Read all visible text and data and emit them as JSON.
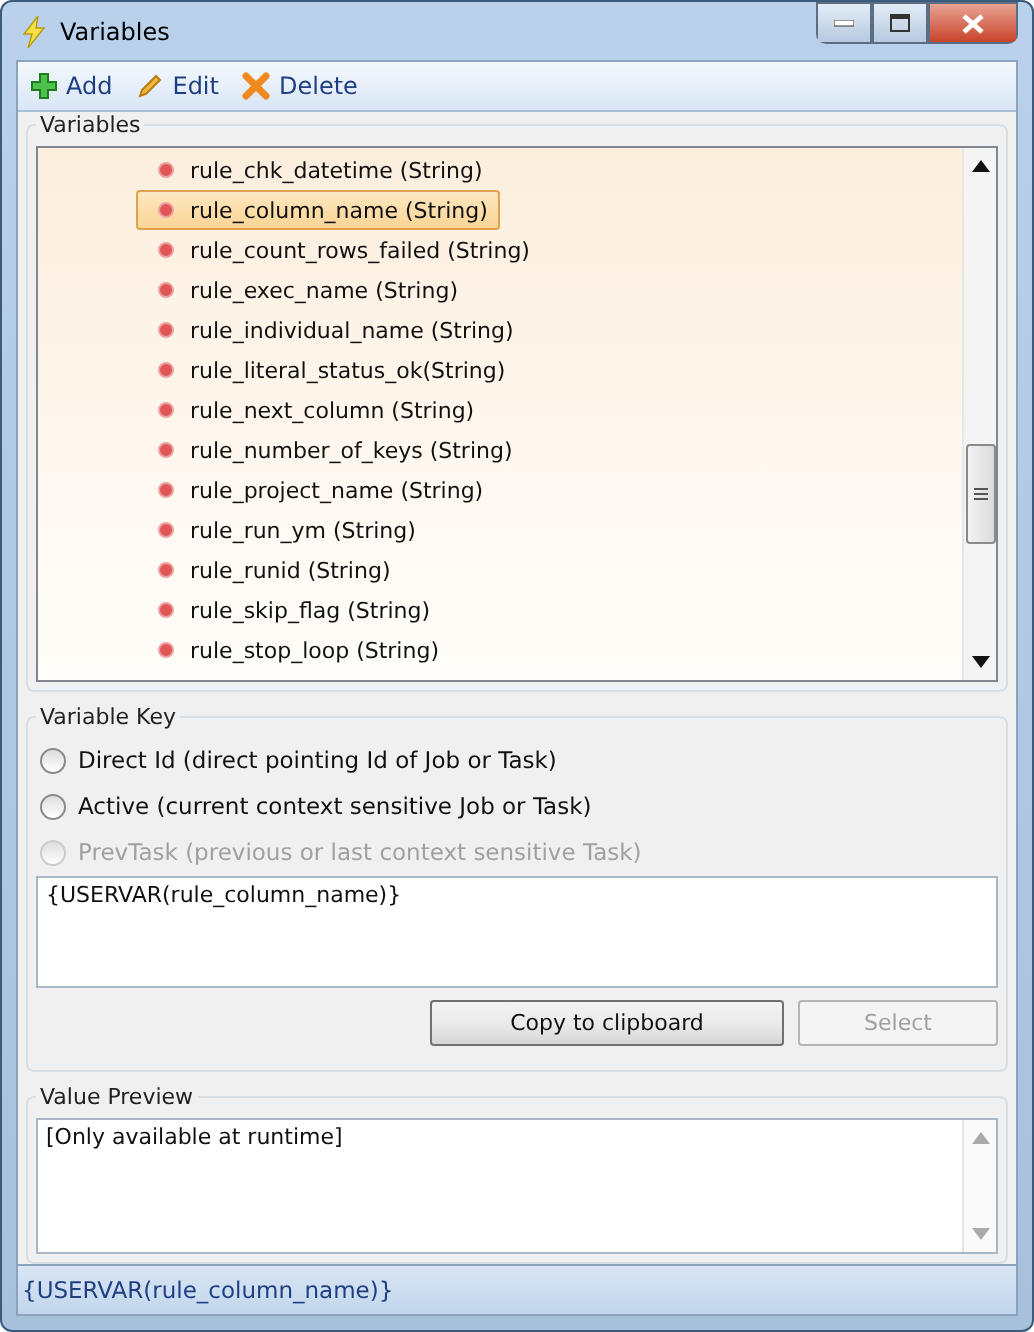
{
  "window": {
    "title": "Variables"
  },
  "toolbar": [
    {
      "kind": "add",
      "label": "Add"
    },
    {
      "kind": "edit",
      "label": "Edit"
    },
    {
      "kind": "delete",
      "label": "Delete"
    }
  ],
  "variables": {
    "title": "Variables",
    "items": [
      {
        "label": "rule_chk_datetime (String)",
        "selected": false
      },
      {
        "label": "rule_column_name (String)",
        "selected": true
      },
      {
        "label": "rule_count_rows_failed (String)",
        "selected": false
      },
      {
        "label": "rule_exec_name (String)",
        "selected": false
      },
      {
        "label": "rule_individual_name (String)",
        "selected": false
      },
      {
        "label": "rule_literal_status_ok(String)",
        "selected": false
      },
      {
        "label": "rule_next_column (String)",
        "selected": false
      },
      {
        "label": "rule_number_of_keys (String)",
        "selected": false
      },
      {
        "label": "rule_project_name (String)",
        "selected": false
      },
      {
        "label": "rule_run_ym (String)",
        "selected": false
      },
      {
        "label": "rule_runid (String)",
        "selected": false
      },
      {
        "label": "rule_skip_flag (String)",
        "selected": false
      },
      {
        "label": "rule_stop_loop (String)",
        "selected": false
      }
    ]
  },
  "variable_key": {
    "title": "Variable Key",
    "options": [
      {
        "label": "Direct Id (direct pointing Id of Job or Task)",
        "selected": false,
        "disabled": false
      },
      {
        "label": "Active (current context sensitive Job or Task)",
        "selected": false,
        "disabled": false
      },
      {
        "label": "PrevTask (previous or last context sensitive Task)",
        "selected": false,
        "disabled": true
      }
    ],
    "value": "{USERVAR(rule_column_name)}",
    "buttons": [
      {
        "label": "Copy to clipboard",
        "disabled": false
      },
      {
        "label": "Select",
        "disabled": true
      }
    ]
  },
  "value_preview": {
    "title": "Value Preview",
    "value": "[Only available at runtime]"
  },
  "status_bar": "{USERVAR(rule_column_name)}"
}
